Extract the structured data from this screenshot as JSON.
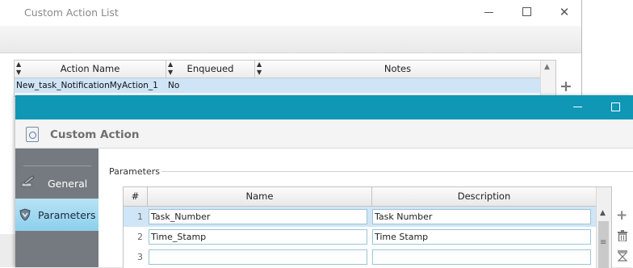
{
  "back_window": {
    "title": "Custom Action List",
    "controls": {
      "minimize": "minimize-icon",
      "maximize": "maximize-icon",
      "close": "✕"
    },
    "grid": {
      "columns": [
        "Action Name",
        "Enqueued",
        "Notes"
      ],
      "rows": [
        {
          "action_name": "New_task_NotificationMyAction_1",
          "enqueued": "No",
          "notes": ""
        }
      ]
    },
    "add_icon": "+"
  },
  "front_window": {
    "title": "",
    "controls": {
      "minimize": "minimize-icon",
      "maximize": "maximize-icon"
    },
    "heading": "Custom Action",
    "sidebar": {
      "items": [
        {
          "label": "General",
          "icon": "pencil-icon",
          "active": false
        },
        {
          "label": "Parameters",
          "icon": "shield-icon",
          "active": true
        }
      ]
    },
    "section_label": "Parameters",
    "params_grid": {
      "columns": [
        "#",
        "Name",
        "Description"
      ],
      "rows": [
        {
          "num": "1",
          "name": "Task_Number",
          "description": "Task Number",
          "selected": true
        },
        {
          "num": "2",
          "name": "Time_Stamp",
          "description": "Time Stamp",
          "selected": false
        },
        {
          "num": "3",
          "name": "",
          "description": "",
          "selected": false
        }
      ]
    },
    "side_actions": {
      "add": "+",
      "delete": "trash-icon",
      "clear": "clear-icon"
    },
    "colors": {
      "titlebar": "#0f97b5",
      "sidebar": "#757a81",
      "selected_row": "#d0e6f7",
      "active_nav": "#8cd0ec"
    }
  }
}
